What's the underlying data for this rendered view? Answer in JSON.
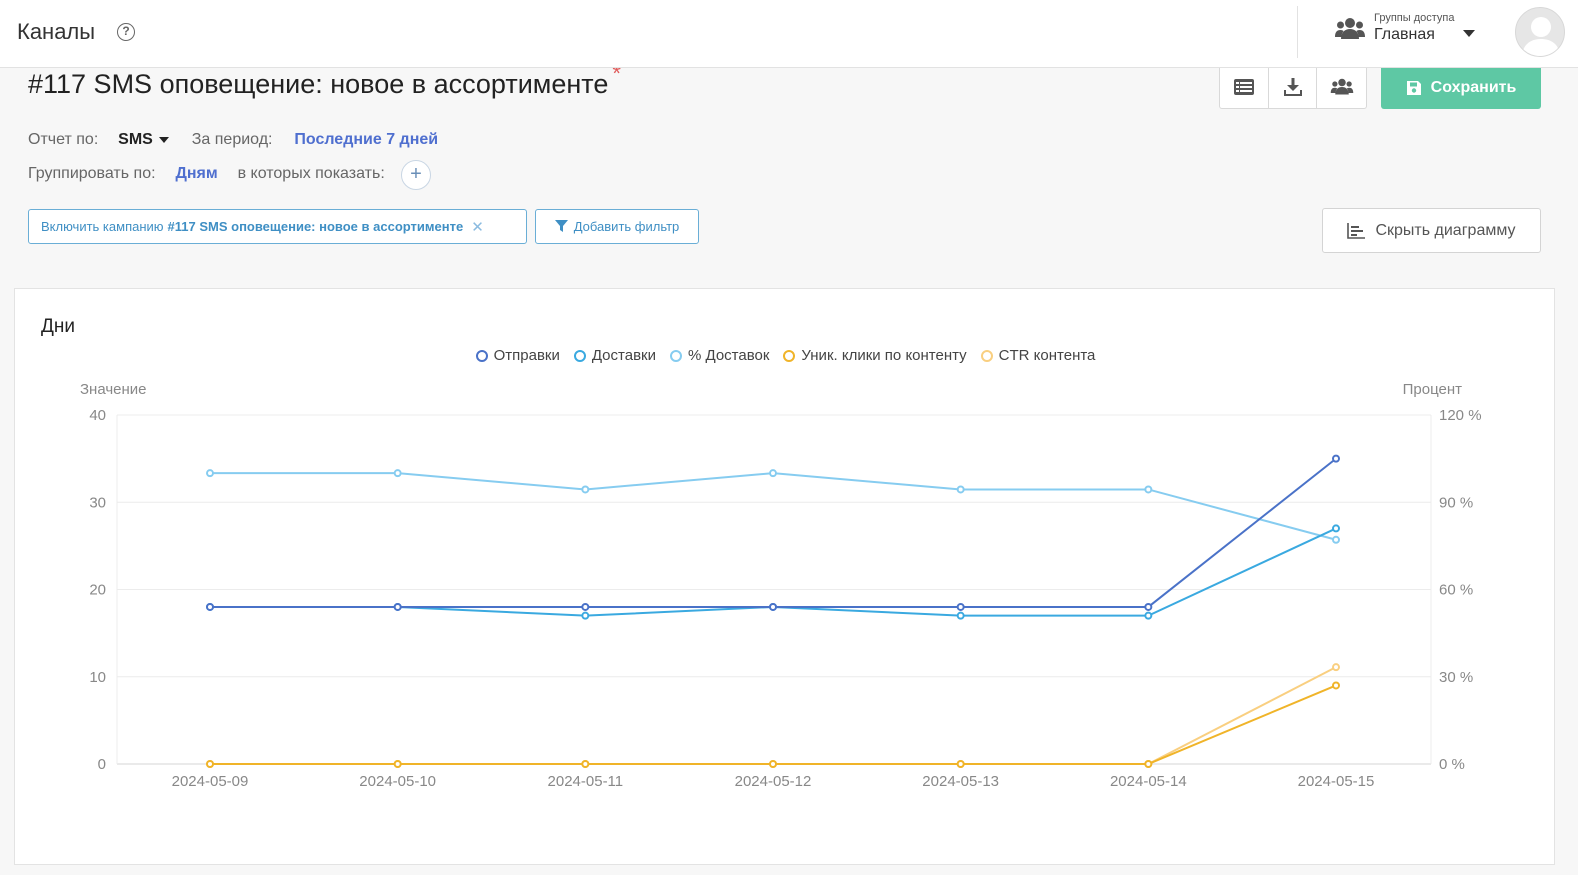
{
  "topbar": {
    "title": "Каналы",
    "help": "?",
    "access_group_label": "Группы доступа",
    "access_group_value": "Главная"
  },
  "report": {
    "title": "#117 SMS оповещение: новое в ассортименте",
    "required_mark": "*",
    "save_label": "Сохранить",
    "report_by_label": "Отчет по:",
    "report_by_value": "SMS",
    "period_label": "За период:",
    "period_value": "Последние 7 дней",
    "group_by_label": "Группировать по:",
    "group_by_value": "Дням",
    "show_in_label": "в которых показать:",
    "filter_chip_prefix": "Включить кампанию",
    "filter_chip_value": "#117 SMS оповещение: новое в ассортименте",
    "add_filter_label": "Добавить фильтр",
    "hide_chart_label": "Скрыть диаграмму"
  },
  "chart_data": {
    "type": "line",
    "title": "Дни",
    "ylabel_left": "Значение",
    "ylabel_right": "Процент",
    "x": [
      "2024-05-09",
      "2024-05-10",
      "2024-05-11",
      "2024-05-12",
      "2024-05-13",
      "2024-05-14",
      "2024-05-15"
    ],
    "ylim_left": [
      0,
      40
    ],
    "yticks_left": [
      "0",
      "10",
      "20",
      "30",
      "40"
    ],
    "ylim_right": [
      0,
      120
    ],
    "yticks_right": [
      "0 %",
      "30 %",
      "60 %",
      "90 %",
      "120 %"
    ],
    "grid": true,
    "legend_position": "top-center",
    "series": [
      {
        "name": "Отправки",
        "axis": "left",
        "color": "#4a72c8",
        "values": [
          18,
          18,
          18,
          18,
          18,
          18,
          35
        ]
      },
      {
        "name": "Доставки",
        "axis": "left",
        "color": "#3aa9e0",
        "values": [
          18,
          18,
          17,
          18,
          17,
          17,
          27
        ]
      },
      {
        "name": "% Доставок",
        "axis": "right",
        "color": "#86ccf0",
        "values": [
          100,
          100,
          94.4,
          100,
          94.4,
          94.4,
          77.1
        ]
      },
      {
        "name": "Уник. клики по контенту",
        "axis": "left",
        "color": "#f0b429",
        "values": [
          0,
          0,
          0,
          0,
          0,
          0,
          9
        ]
      },
      {
        "name": "CTR контента",
        "axis": "right",
        "color": "#f9cf80",
        "values": [
          0,
          0,
          0,
          0,
          0,
          0,
          33.3
        ]
      }
    ]
  }
}
